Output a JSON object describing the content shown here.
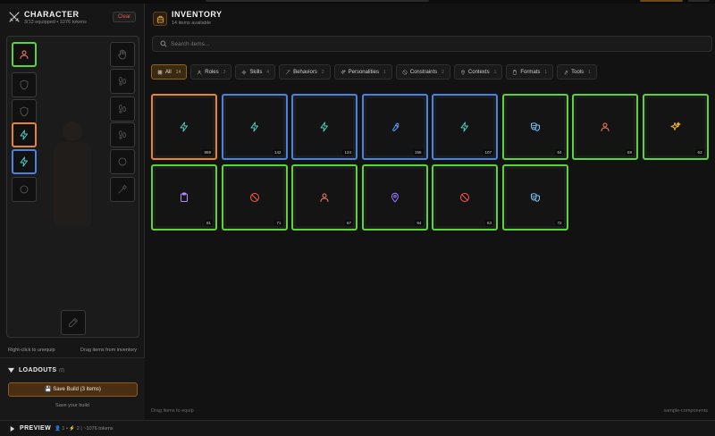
{
  "character": {
    "title": "CHARACTER",
    "subtitle": "3/13 equipped • 1076 tokens",
    "clear_label": "Clear",
    "hint_left": "Right-click to unequip",
    "hint_right": "Drag items from inventory"
  },
  "loadouts": {
    "title": "LOADOUTS",
    "count": "(0)",
    "save_label": "💾 Save Build (3 items)",
    "save_sub": "Save your build"
  },
  "inventory": {
    "title": "INVENTORY",
    "subtitle": "14 items available",
    "search_placeholder": "Search items...",
    "footer_left": "Drag items to equip",
    "footer_right": "sample-components"
  },
  "tabs": [
    {
      "label": "All",
      "count": "14",
      "icon": "grid-icon"
    },
    {
      "label": "Roles",
      "count": "2",
      "icon": "person-icon"
    },
    {
      "label": "Skills",
      "count": "4",
      "icon": "sparkle-icon"
    },
    {
      "label": "Behaviors",
      "count": "2",
      "icon": "magic-wand-icon"
    },
    {
      "label": "Personalities",
      "count": "1",
      "icon": "sparkles-icon"
    },
    {
      "label": "Constraints",
      "count": "2",
      "icon": "ban-icon"
    },
    {
      "label": "Contexts",
      "count": "1",
      "icon": "map-pin-icon"
    },
    {
      "label": "Formats",
      "count": "1",
      "icon": "clipboard-icon"
    },
    {
      "label": "Tools",
      "count": "1",
      "icon": "wrench-icon"
    }
  ],
  "items": [
    {
      "icon": "bolt-icon",
      "tokens": "869",
      "rarity": "orange",
      "color": "#4fd1c5"
    },
    {
      "icon": "bolt-icon",
      "tokens": "142",
      "rarity": "blue",
      "color": "#4fd1c5"
    },
    {
      "icon": "bolt-icon",
      "tokens": "124",
      "rarity": "blue",
      "color": "#4fd1c5"
    },
    {
      "icon": "wrench-icon",
      "tokens": "155",
      "rarity": "blue",
      "color": "#5aa2ff"
    },
    {
      "icon": "bolt-icon",
      "tokens": "107",
      "rarity": "blue",
      "color": "#4fd1c5"
    },
    {
      "icon": "theater-masks-icon",
      "tokens": "64",
      "rarity": "green",
      "color": "#7fc8ff"
    },
    {
      "icon": "person-icon",
      "tokens": "69",
      "rarity": "green",
      "color": "#ff7a6a"
    },
    {
      "icon": "sparkles-icon",
      "tokens": "63",
      "rarity": "green",
      "color": "#f5b83a"
    },
    {
      "icon": "clipboard-icon",
      "tokens": "81",
      "rarity": "green",
      "color": "#b48cff"
    },
    {
      "icon": "ban-icon",
      "tokens": "71",
      "rarity": "green",
      "color": "#ff5a4a"
    },
    {
      "icon": "person-icon",
      "tokens": "67",
      "rarity": "green",
      "color": "#ff7a6a"
    },
    {
      "icon": "map-pin-icon",
      "tokens": "64",
      "rarity": "green",
      "color": "#9a7cff"
    },
    {
      "icon": "ban-icon",
      "tokens": "63",
      "rarity": "green",
      "color": "#ff5a4a"
    },
    {
      "icon": "theater-masks-icon",
      "tokens": "72",
      "rarity": "green",
      "color": "#7fc8ff"
    }
  ],
  "slots": [
    {
      "icon": "person-icon",
      "state": "green",
      "color": "#ff7a6a"
    },
    {
      "icon": "shield-icon",
      "state": "empty",
      "color": "#5a5a5a"
    },
    {
      "icon": "shield-icon",
      "state": "empty",
      "color": "#5a5a5a"
    },
    {
      "icon": "bolt-icon",
      "state": "orange",
      "color": "#4fd1c5"
    },
    {
      "icon": "bolt-icon",
      "state": "blue",
      "color": "#4fd1c5"
    },
    {
      "icon": "ring-icon",
      "state": "empty",
      "color": "#5a5a5a"
    },
    {
      "icon": "hand-icon",
      "state": "empty",
      "color": "#5a5a5a"
    },
    {
      "icon": "footprints-icon",
      "state": "empty",
      "color": "#5a5a5a"
    },
    {
      "icon": "footprints-icon",
      "state": "empty",
      "color": "#5a5a5a"
    },
    {
      "icon": "footprints-icon",
      "state": "empty",
      "color": "#5a5a5a"
    },
    {
      "icon": "ring-icon",
      "state": "empty",
      "color": "#5a5a5a"
    },
    {
      "icon": "hammer-icon",
      "state": "empty",
      "color": "#5a5a5a"
    },
    {
      "icon": "pencil-icon",
      "state": "empty",
      "color": "#5a5a5a"
    }
  ],
  "preview": {
    "title": "PREVIEW",
    "stats": "👤 1 • ⚡ 2 | ~1076 tokens"
  },
  "colors": {
    "accent": "#e8852c",
    "rarity_green": "#5fd13a",
    "rarity_blue": "#4a82e0",
    "rarity_orange": "#e8852c"
  }
}
